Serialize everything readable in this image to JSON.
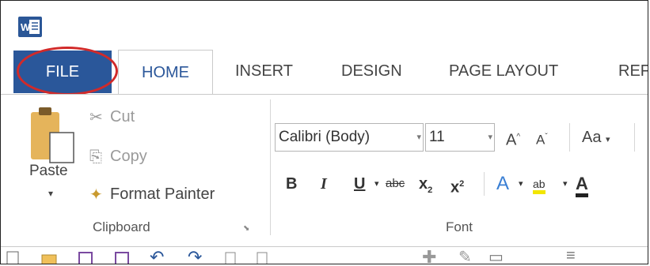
{
  "app": {
    "icon": "word-app-icon",
    "icon_letter": "W"
  },
  "tabs": {
    "file": "FILE",
    "home": "HOME",
    "insert": "INSERT",
    "design": "DESIGN",
    "page_layout": "PAGE LAYOUT",
    "references_partial": "REFE"
  },
  "clipboard": {
    "paste": "Paste",
    "cut": "Cut",
    "copy": "Copy",
    "format_painter": "Format Painter",
    "group_label": "Clipboard"
  },
  "font": {
    "font_name": "Calibri (Body)",
    "font_size": "11",
    "grow": "A",
    "shrink": "A",
    "change_case": "Aa",
    "bold": "B",
    "italic": "I",
    "underline": "U",
    "strikethrough": "abc",
    "subscript": "x",
    "sub_mark": "2",
    "superscript": "x",
    "sup_mark": "2",
    "text_effects": "A",
    "highlight": "ab",
    "font_color": "A",
    "group_label": "Font"
  },
  "colors": {
    "file_tab_bg": "#2a579a",
    "home_accent": "#2b579a",
    "highlight_circle": "#d12a2a",
    "highlight_yellow": "#f2e600"
  }
}
